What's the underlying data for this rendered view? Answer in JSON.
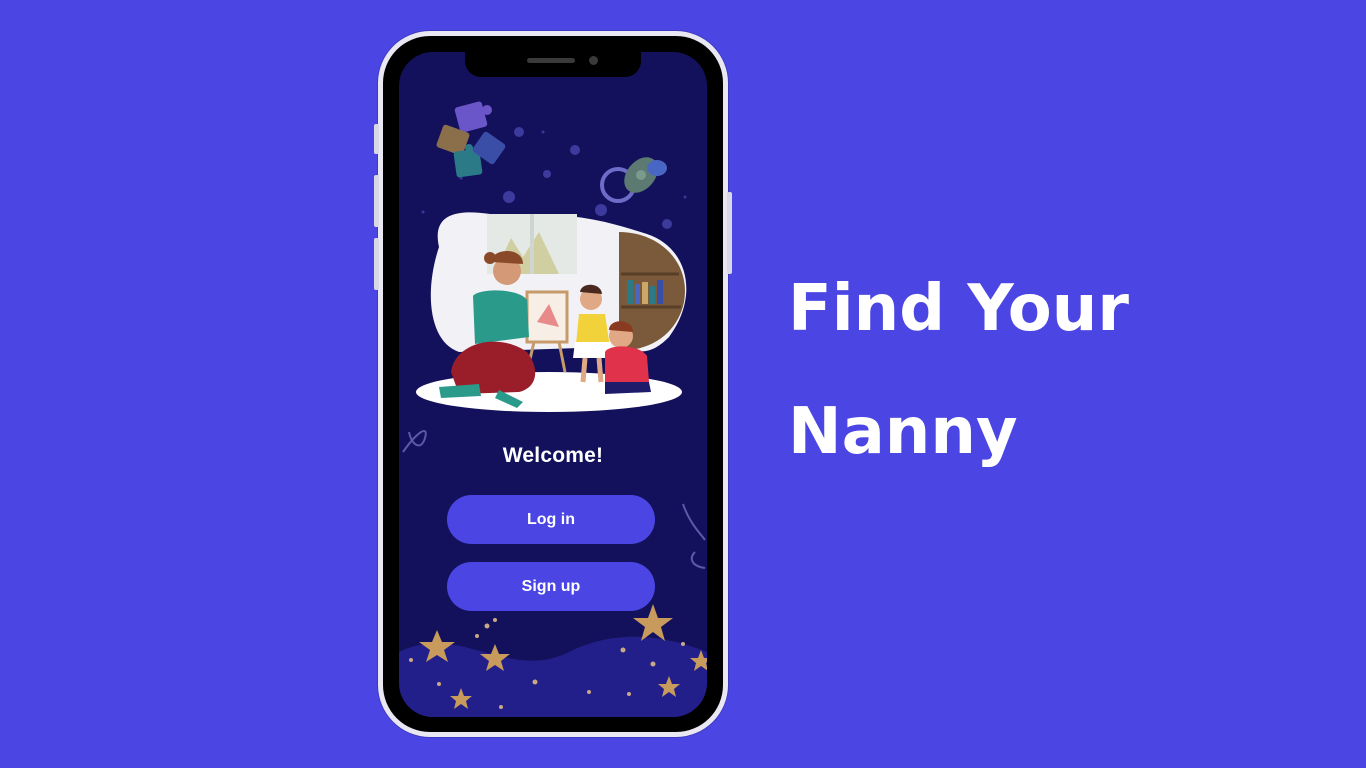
{
  "colors": {
    "background": "#4b46e3",
    "screen": "#14115c",
    "button": "#4b46e3",
    "text": "#ffffff",
    "star": "#c89a5c"
  },
  "app": {
    "welcome": "Welcome!",
    "login_label": "Log in",
    "signup_label": "Sign up",
    "illustration": "nanny-painting-with-children-illustration"
  },
  "headline": {
    "line1": "Find Your",
    "line2": "Nanny"
  }
}
